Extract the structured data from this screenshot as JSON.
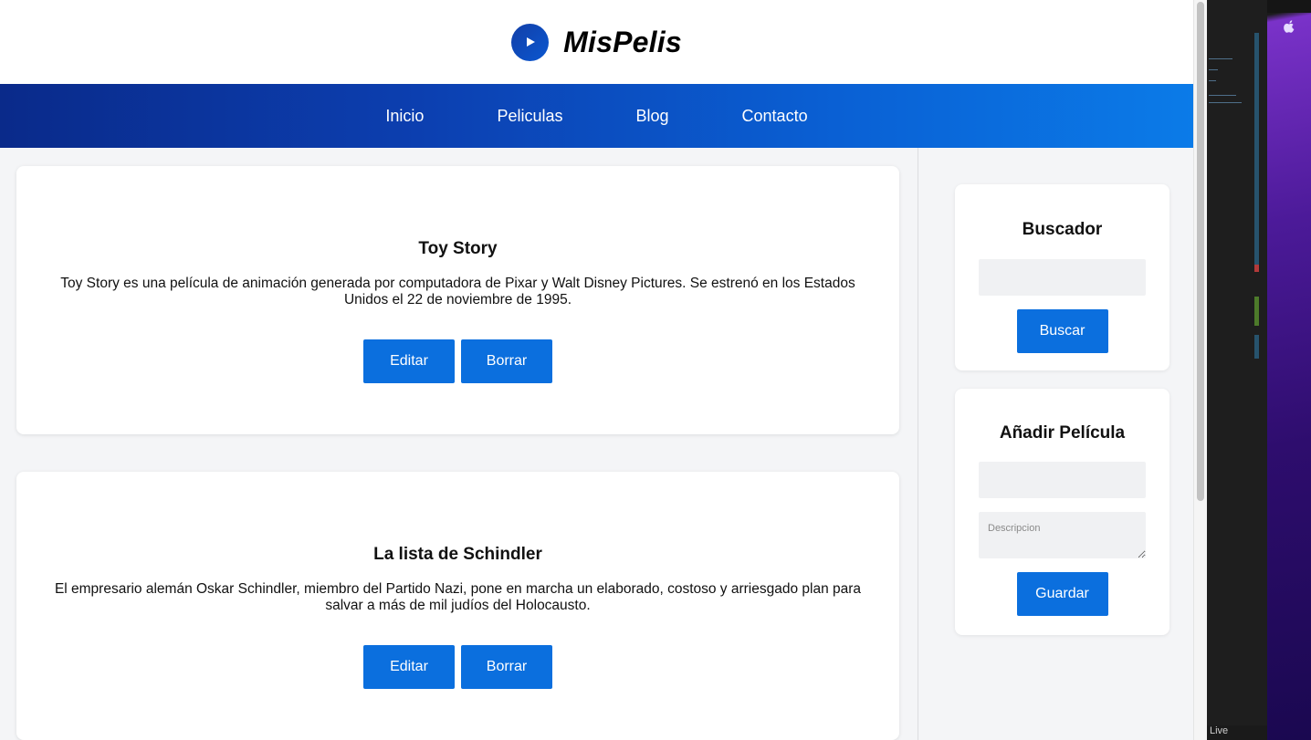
{
  "site": {
    "logo_text": "MisPelis"
  },
  "nav": {
    "items": [
      {
        "label": "Inicio"
      },
      {
        "label": "Peliculas"
      },
      {
        "label": "Blog"
      },
      {
        "label": "Contacto"
      }
    ]
  },
  "movies": [
    {
      "title": "Toy Story",
      "description": "Toy Story es una película de animación generada por computadora de Pixar y Walt Disney Pictures. Se estrenó en los Estados Unidos el 22 de noviembre de 1995.",
      "edit_label": "Editar",
      "delete_label": "Borrar"
    },
    {
      "title": "La lista de Schindler",
      "description": "El empresario alemán Oskar Schindler, miembro del Partido Nazi, pone en marcha un elaborado, costoso y arriesgado plan para salvar a más de mil judíos del Holocausto.",
      "edit_label": "Editar",
      "delete_label": "Borrar"
    }
  ],
  "search": {
    "title": "Buscador",
    "input_value": "",
    "button_label": "Buscar"
  },
  "add_movie": {
    "title": "Añadir Película",
    "title_input_value": "",
    "description_placeholder": "Descripcion",
    "button_label": "Guardar"
  },
  "editor": {
    "status_text": "Live"
  },
  "colors": {
    "accent": "#0b6fde",
    "nav_start": "#0a2a8a",
    "nav_end": "#0b7be8"
  }
}
